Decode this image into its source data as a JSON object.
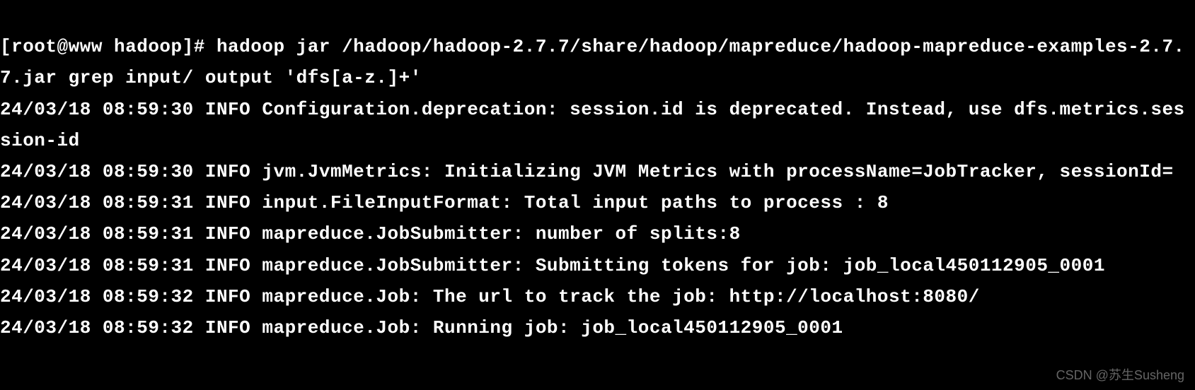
{
  "terminal": {
    "lines": [
      "[root@www hadoop]# hadoop jar /hadoop/hadoop-2.7.7/share/hadoop/mapreduce/hadoop-mapreduce-examples-2.7.7.jar grep input/ output 'dfs[a-z.]+'",
      "24/03/18 08:59:30 INFO Configuration.deprecation: session.id is deprecated. Instead, use dfs.metrics.session-id",
      "24/03/18 08:59:30 INFO jvm.JvmMetrics: Initializing JVM Metrics with processName=JobTracker, sessionId=",
      "24/03/18 08:59:31 INFO input.FileInputFormat: Total input paths to process : 8",
      "24/03/18 08:59:31 INFO mapreduce.JobSubmitter: number of splits:8",
      "24/03/18 08:59:31 INFO mapreduce.JobSubmitter: Submitting tokens for job: job_local450112905_0001",
      "24/03/18 08:59:32 INFO mapreduce.Job: The url to track the job: http://localhost:8080/",
      "24/03/18 08:59:32 INFO mapreduce.Job: Running job: job_local450112905_0001"
    ]
  },
  "watermark": "CSDN @苏生Susheng"
}
